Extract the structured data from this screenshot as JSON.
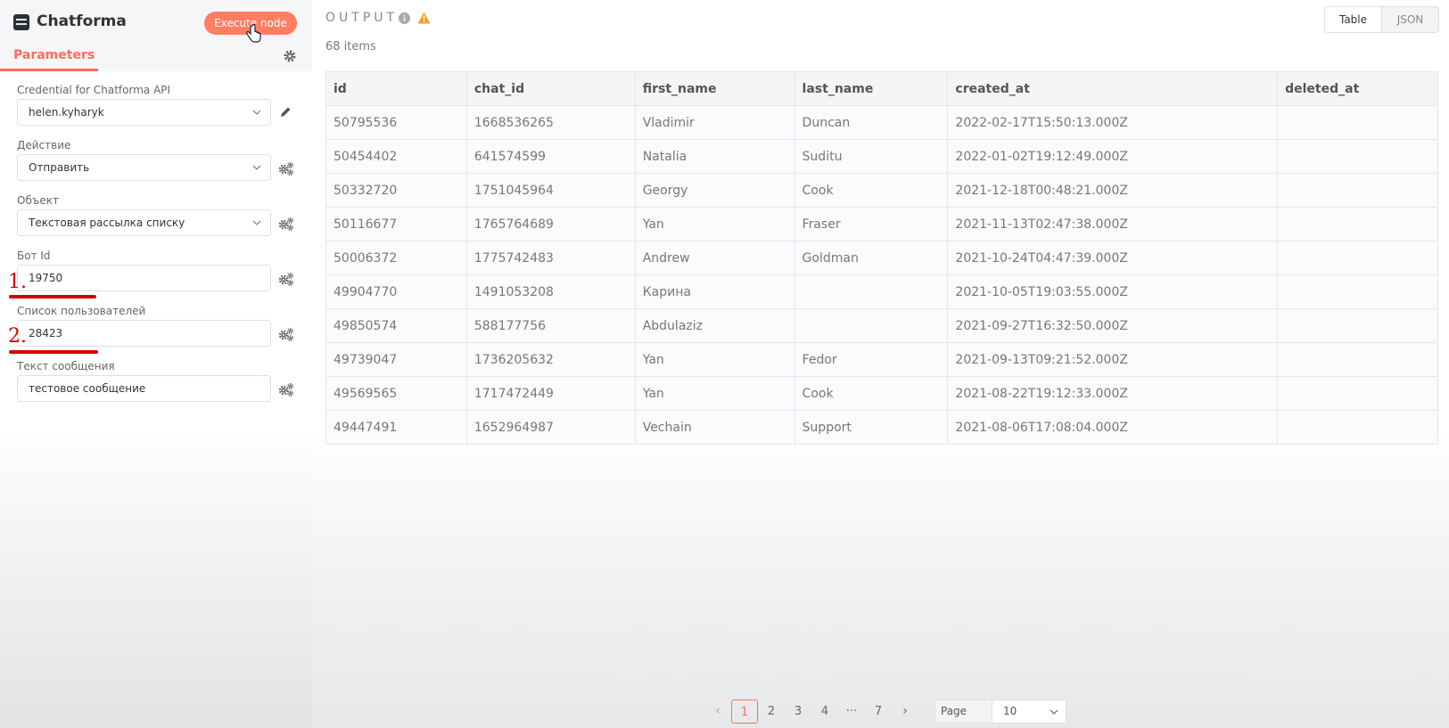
{
  "node": {
    "title": "Chatforma",
    "execute_label": "Execute node",
    "tab_label": "Parameters"
  },
  "params": [
    {
      "label": "Credential for Chatforma API",
      "value": "helen.kyharyk",
      "type": "select",
      "side_icon": "pencil-icon"
    },
    {
      "label": "Действие",
      "value": "Отправить",
      "type": "select",
      "side_icon": "gears-icon"
    },
    {
      "label": "Объект",
      "value": "Текстовая рассылка списку",
      "type": "select",
      "side_icon": "gears-icon"
    },
    {
      "label": "Бот Id",
      "value": "19750",
      "type": "input",
      "side_icon": "gears-icon"
    },
    {
      "label": "Список пользователей",
      "value": "28423",
      "type": "input",
      "side_icon": "gears-icon"
    },
    {
      "label": "Текст сообщения",
      "value": "тестовое сообщение",
      "type": "input",
      "side_icon": "gears-icon"
    }
  ],
  "annotations": [
    "1.",
    "2."
  ],
  "output": {
    "title": "OUTPUT",
    "count_text": "68 items",
    "view_toggle": [
      "Table",
      "JSON"
    ],
    "columns": [
      "id",
      "chat_id",
      "first_name",
      "last_name",
      "created_at",
      "deleted_at"
    ],
    "rows": [
      [
        "50795536",
        "1668536265",
        "Vladimir",
        "Duncan",
        "2022-02-17T15:50:13.000Z",
        ""
      ],
      [
        "50454402",
        "641574599",
        "Natalia",
        "Suditu",
        "2022-01-02T19:12:49.000Z",
        ""
      ],
      [
        "50332720",
        "1751045964",
        "Georgy",
        "Cook",
        "2021-12-18T00:48:21.000Z",
        ""
      ],
      [
        "50116677",
        "1765764689",
        "Yan",
        "Fraser",
        "2021-11-13T02:47:38.000Z",
        ""
      ],
      [
        "50006372",
        "1775742483",
        "Andrew",
        "Goldman",
        "2021-10-24T04:47:39.000Z",
        ""
      ],
      [
        "49904770",
        "1491053208",
        "Карина",
        "",
        "2021-10-05T19:03:55.000Z",
        ""
      ],
      [
        "49850574",
        "588177756",
        "Abdulaziz",
        "",
        "2021-09-27T16:32:50.000Z",
        ""
      ],
      [
        "49739047",
        "1736205632",
        "Yan",
        "Fedor",
        "2021-09-13T09:21:52.000Z",
        ""
      ],
      [
        "49569565",
        "1717472449",
        "Yan",
        "Cook",
        "2021-08-22T19:12:33.000Z",
        ""
      ],
      [
        "49447491",
        "1652964987",
        "Vechain",
        "Support",
        "2021-08-06T17:08:04.000Z",
        ""
      ]
    ]
  },
  "pagination": {
    "pages": [
      "1",
      "2",
      "3",
      "4",
      "···",
      "7"
    ],
    "current": "1",
    "page_size_label": "Page Size",
    "page_size_value": "10"
  },
  "colors": {
    "accent": "#ff6d5a",
    "execute_button": "#ff7d63",
    "annotation_red": "#d40000",
    "warning": "#f0a020"
  }
}
